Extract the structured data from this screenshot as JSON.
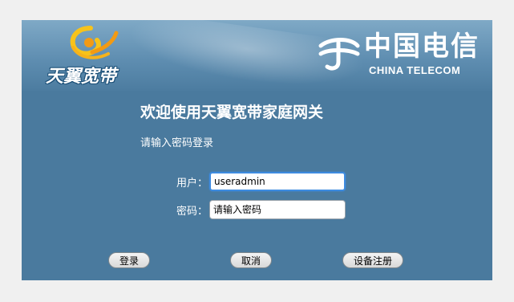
{
  "header": {
    "brand_left": "天翼宽带",
    "brand_right_cn": "中国电信",
    "brand_right_en": "CHINA TELECOM"
  },
  "main": {
    "title": "欢迎使用天翼宽带家庭网关",
    "subtitle": "请输入密码登录"
  },
  "form": {
    "user_label": "用户：",
    "user_value": "useradmin",
    "password_label": "密码：",
    "password_placeholder": "请输入密码"
  },
  "buttons": {
    "login": "登录",
    "cancel": "取消",
    "register": "设备注册"
  },
  "colors": {
    "background": "#4a7a9e",
    "page": "#f0f0f0",
    "input_focus": "#3d8be0"
  }
}
